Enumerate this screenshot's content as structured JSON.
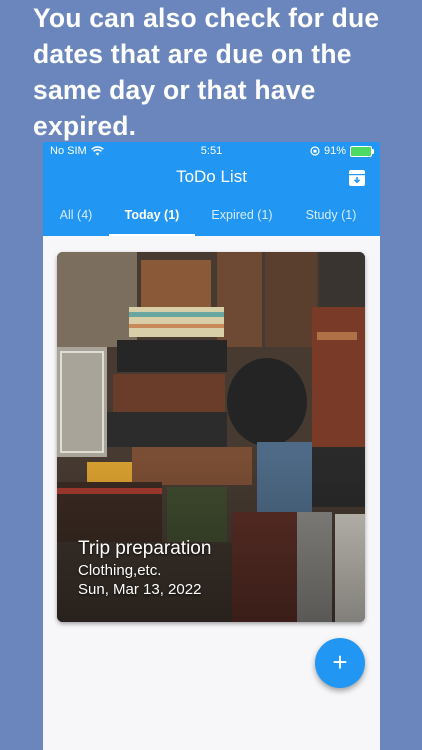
{
  "promo_text": "You can also check for due dates that are due on the same day or that have expired.",
  "status_bar": {
    "carrier": "No SIM",
    "time": "5:51",
    "battery": "91%"
  },
  "app_bar": {
    "title": "ToDo List"
  },
  "tabs": [
    {
      "label": "All (4)",
      "active": false
    },
    {
      "label": "Today (1)",
      "active": true
    },
    {
      "label": "Expired (1)",
      "active": false
    },
    {
      "label": "Study (1)",
      "active": false
    }
  ],
  "task_card": {
    "title": "Trip preparation",
    "subtitle": "Clothing,etc.",
    "due_date": "Sun, Mar 13, 2022"
  },
  "fab": {
    "label": "+"
  },
  "colors": {
    "background": "#6a86bd",
    "accent": "#2196f3",
    "battery": "#4cd964"
  }
}
